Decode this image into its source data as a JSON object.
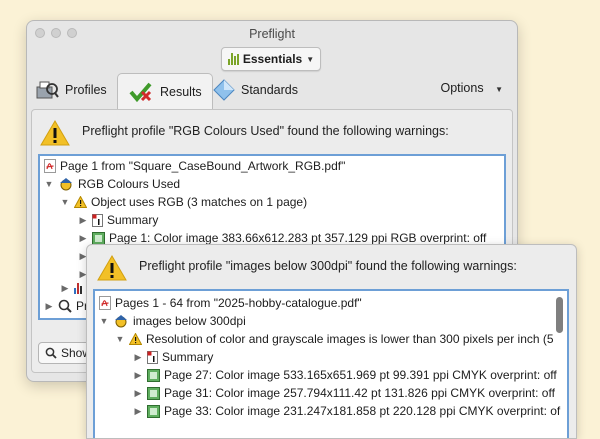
{
  "window": {
    "title": "Preflight"
  },
  "toolbar": {
    "essentials_label": "Essentials"
  },
  "tabs": [
    {
      "label": "Profiles"
    },
    {
      "label": "Results"
    },
    {
      "label": "Standards"
    }
  ],
  "options_label": "Options",
  "colors": {
    "accent_border": "#6d9fd6",
    "warning_yellow": "#f2c027",
    "background": "#fbf2d6"
  },
  "results1": {
    "message": "Preflight profile \"RGB Colours Used\" found the following warnings:",
    "tree": [
      {
        "text": "Page 1 from \"Square_CaseBound_Artwork_RGB.pdf\"",
        "icon": "pdf-icon"
      },
      {
        "text": "RGB Colours Used",
        "icon": "profile-icon"
      },
      {
        "text": "Object uses RGB (3 matches on 1 page)",
        "icon": "warning-icon"
      },
      {
        "text": "Summary",
        "icon": "info-doc-icon"
      },
      {
        "text": "Page 1: Color image 383.66x612.283 pt 357.129 ppi RGB  overprint: off",
        "icon": "image-icon"
      },
      {
        "text": "Pr",
        "icon": "search-icon"
      }
    ],
    "show_button": "Show"
  },
  "results2": {
    "message": "Preflight profile \"images below 300dpi\" found the following warnings:",
    "tree": [
      {
        "text": "Pages 1 - 64 from \"2025-hobby-catalogue.pdf\"",
        "icon": "pdf-icon"
      },
      {
        "text": "images below 300dpi",
        "icon": "profile-icon"
      },
      {
        "text": "Resolution of color and grayscale images is lower than 300 pixels per inch (5",
        "icon": "warning-icon"
      },
      {
        "text": "Summary",
        "icon": "info-doc-icon"
      },
      {
        "text": "Page 27: Color image 533.165x651.969 pt 99.391 ppi CMYK  overprint: off",
        "icon": "image-icon"
      },
      {
        "text": "Page 31: Color image 257.794x111.42 pt 131.826 ppi CMYK  overprint: off",
        "icon": "image-icon"
      },
      {
        "text": "Page 33: Color image 231.247x181.858 pt 220.128 ppi CMYK  overprint: of",
        "icon": "image-icon"
      }
    ]
  }
}
